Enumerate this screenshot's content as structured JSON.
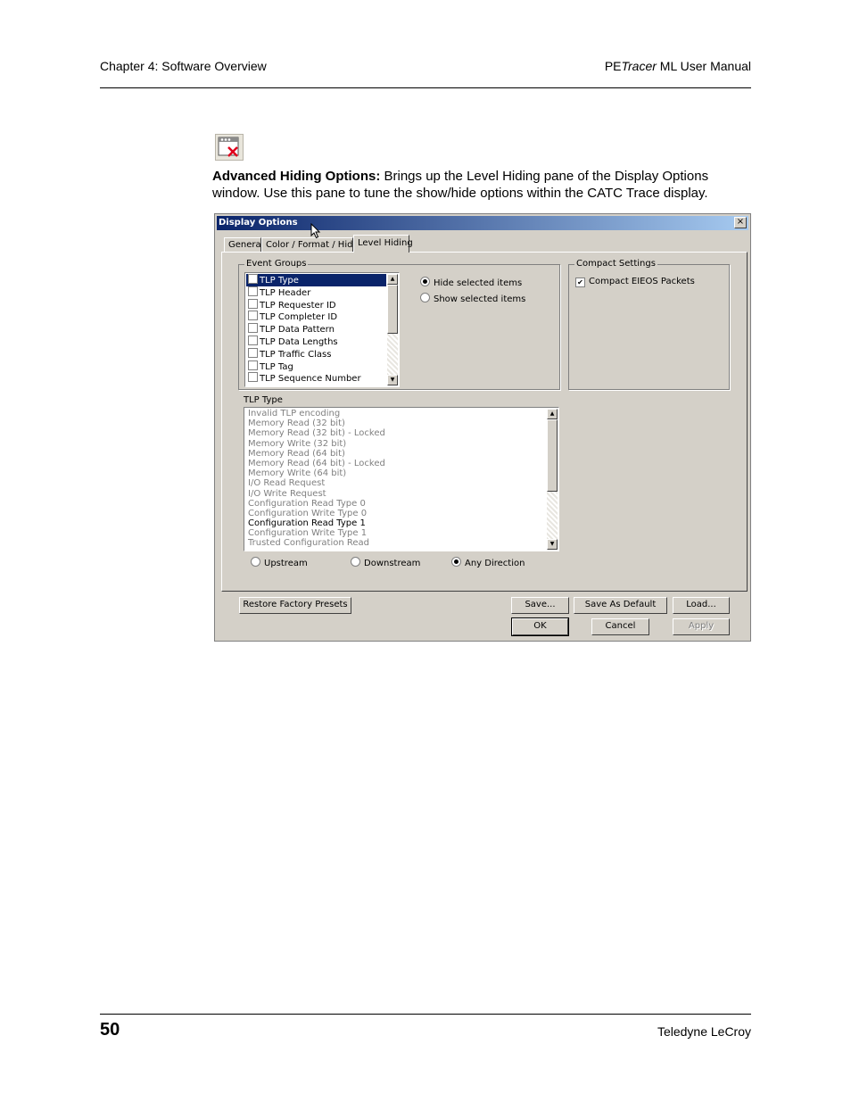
{
  "header": {
    "chapter": "Chapter 4: Software Overview",
    "manual_prefix": "PE",
    "manual_italic": "Tracer",
    "manual_suffix": " ML User Manual"
  },
  "intro": {
    "term": "Advanced Hiding Options:",
    "text": " Brings up the Level Hiding pane of the Display Options window. Use this pane to tune the show/hide options within the CATC Trace display."
  },
  "dialog": {
    "title": "Display Options",
    "close_label": "×",
    "tabs": [
      "General",
      "Color / Format / Hiding",
      "Level Hiding"
    ],
    "event_groups": {
      "label": "Event Groups",
      "items": [
        {
          "label": "TLP Type",
          "selected": true
        },
        {
          "label": "TLP Header",
          "selected": false
        },
        {
          "label": "TLP Requester ID",
          "selected": false
        },
        {
          "label": "TLP Completer ID",
          "selected": false
        },
        {
          "label": "TLP Data Pattern",
          "selected": false
        },
        {
          "label": "TLP Data Lengths",
          "selected": false
        },
        {
          "label": "TLP Traffic Class",
          "selected": false
        },
        {
          "label": "TLP Tag",
          "selected": false
        },
        {
          "label": "TLP Sequence Number",
          "selected": false
        }
      ],
      "hide_option": "Hide selected items",
      "show_option": "Show selected items",
      "selected_option": "hide"
    },
    "compact_settings": {
      "label": "Compact Settings",
      "checkbox_label": "Compact EIEOS Packets",
      "checked": true
    },
    "tlp_type": {
      "label": "TLP Type",
      "items": [
        {
          "label": "Invalid TLP encoding",
          "active": false
        },
        {
          "label": "Memory Read (32 bit)",
          "active": false
        },
        {
          "label": "Memory Read (32 bit) - Locked",
          "active": false
        },
        {
          "label": "Memory Write (32 bit)",
          "active": false
        },
        {
          "label": "Memory Read (64 bit)",
          "active": false
        },
        {
          "label": "Memory Read (64 bit) - Locked",
          "active": false
        },
        {
          "label": "Memory Write (64 bit)",
          "active": false
        },
        {
          "label": "I/O Read Request",
          "active": false
        },
        {
          "label": "I/O Write Request",
          "active": false
        },
        {
          "label": "Configuration Read Type 0",
          "active": false
        },
        {
          "label": "Configuration Write Type 0",
          "active": false
        },
        {
          "label": "Configuration Read Type 1",
          "active": true
        },
        {
          "label": "Configuration Write Type 1",
          "active": false
        },
        {
          "label": "Trusted Configuration Read",
          "active": false
        }
      ]
    },
    "direction": {
      "upstream": "Upstream",
      "downstream": "Downstream",
      "any": "Any Direction",
      "selected": "any"
    },
    "buttons": {
      "restore": "Restore Factory Presets",
      "save": "Save...",
      "save_default": "Save As Default",
      "load": "Load...",
      "ok": "OK",
      "cancel": "Cancel",
      "apply": "Apply"
    }
  },
  "footer": {
    "page_number": "50",
    "company": "Teledyne LeCroy"
  }
}
